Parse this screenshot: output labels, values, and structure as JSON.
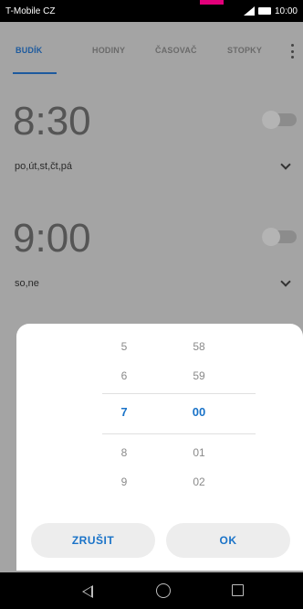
{
  "status_bar": {
    "carrier": "T-Mobile CZ",
    "time": "10:00"
  },
  "tabs": [
    {
      "label": "BUDÍK",
      "active": true
    },
    {
      "label": "HODINY",
      "active": false
    },
    {
      "label": "ČASOVAČ",
      "active": false
    },
    {
      "label": "STOPKY",
      "active": false
    }
  ],
  "alarms": [
    {
      "time": "8:30",
      "days": "po,út,st,čt,pá",
      "enabled": false
    },
    {
      "time": "9:00",
      "days": "so,ne",
      "enabled": false
    }
  ],
  "picker": {
    "hours": [
      "5",
      "6",
      "7",
      "8",
      "9"
    ],
    "minutes": [
      "58",
      "59",
      "00",
      "01",
      "02"
    ],
    "selected_hour": "7",
    "selected_minute": "00"
  },
  "buttons": {
    "cancel": "ZRUŠIT",
    "ok": "OK"
  },
  "colors": {
    "accent": "#1a73c8",
    "tab_active": "#1d5a9e",
    "brand": "#e2007a"
  }
}
